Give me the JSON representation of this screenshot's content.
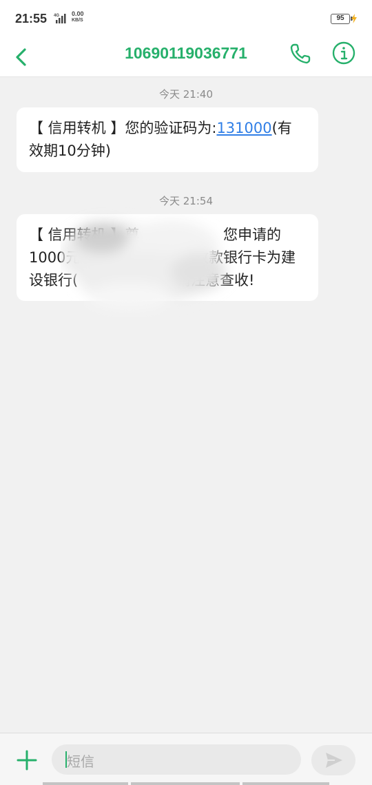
{
  "status_bar": {
    "time": "21:55",
    "network": "4G",
    "speed_value": "0.00",
    "speed_unit": "KB/S",
    "battery": "95"
  },
  "header": {
    "contact": "10690119036771",
    "back_icon": "chevron-left-icon",
    "call_icon": "phone-icon",
    "info_icon": "info-icon",
    "accent_color": "#26b06b"
  },
  "messages": [
    {
      "timestamp": "今天 21:40",
      "text_before": "【 信用转机 】您的验证码为:",
      "code": "131000",
      "text_after": "(有效期10分钟)"
    },
    {
      "timestamp": "今天 21:54",
      "line1": "【 信用转机 】尊",
      "line1_tail": "您申请的",
      "line2": "1000元已",
      "line2_tail": "收款银行卡为建",
      "line3": "设银行(",
      "line3_tail": "请注意查收!"
    }
  ],
  "composer": {
    "placeholder": "短信",
    "add_icon": "plus-icon",
    "send_icon": "send-icon"
  }
}
